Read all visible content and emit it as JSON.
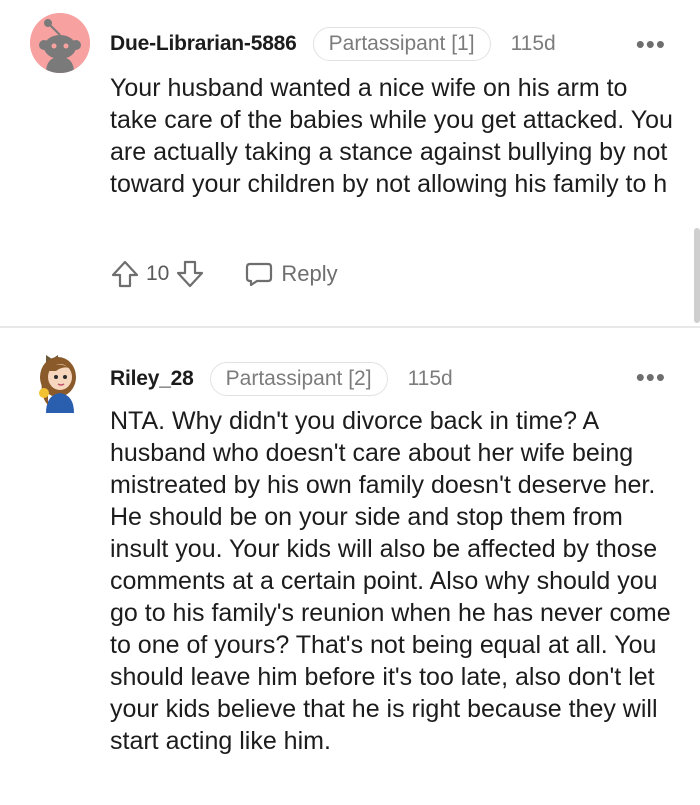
{
  "comments": [
    {
      "username": "Due-Librarian-5886",
      "flair": "Partassipant [1]",
      "age": "115d",
      "more": "•••",
      "body": "Your husband wanted a nice wife on his arm to take care of the babies while you get attacked. You are actually taking a stance against bullying by not toward your children by not allowing his family to h",
      "votes": "10",
      "reply_label": "Reply",
      "avatar_icon": "snoo-avatar-icon",
      "avatar_color": "#f5a3a3"
    },
    {
      "username": "Riley_28",
      "flair": "Partassipant [2]",
      "age": "115d",
      "more": "•••",
      "body": "NTA. Why didn't you divorce back in time? A husband who doesn't care about her wife being mistreated by his own family doesn't deserve her. He should be on your side and stop them from insult you. Your kids will also be affected by those comments at a certain point. Also why should you go to his family's reunion when he has never come to one of yours? That's not being equal at all. You should leave him before it's too late, also don't let your kids believe that he is right because they will start acting like him.",
      "avatar_icon": "cartoon-girl-avatar-icon"
    }
  ]
}
